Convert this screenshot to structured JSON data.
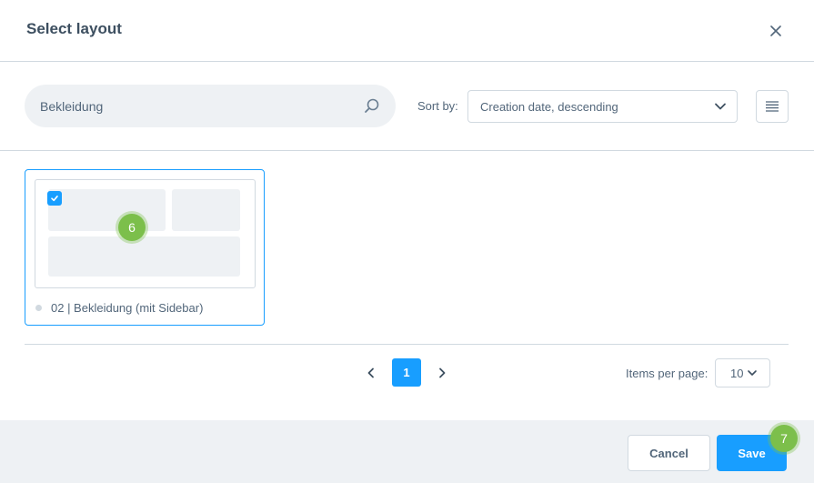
{
  "header": {
    "title": "Select layout",
    "close_icon": "close-icon"
  },
  "toolbar": {
    "search_value": "Bekleidung",
    "search_icon": "search-icon",
    "sort_label": "Sort by:",
    "sort_value": "Creation date, descending",
    "view_toggle_icon": "list-view-icon"
  },
  "layouts": [
    {
      "name": "02 | Bekleidung (mit Sidebar)",
      "selected": true
    }
  ],
  "annotations": {
    "card_marker": "6",
    "save_marker": "7"
  },
  "pagination": {
    "current_page": "1",
    "items_per_page_label": "Items per page:",
    "items_per_page_value": "10"
  },
  "footer": {
    "cancel_label": "Cancel",
    "save_label": "Save"
  },
  "colors": {
    "accent": "#189eff",
    "marker": "#7cbf4b",
    "muted_bg": "#eef1f4",
    "border": "#d1d9e0"
  }
}
